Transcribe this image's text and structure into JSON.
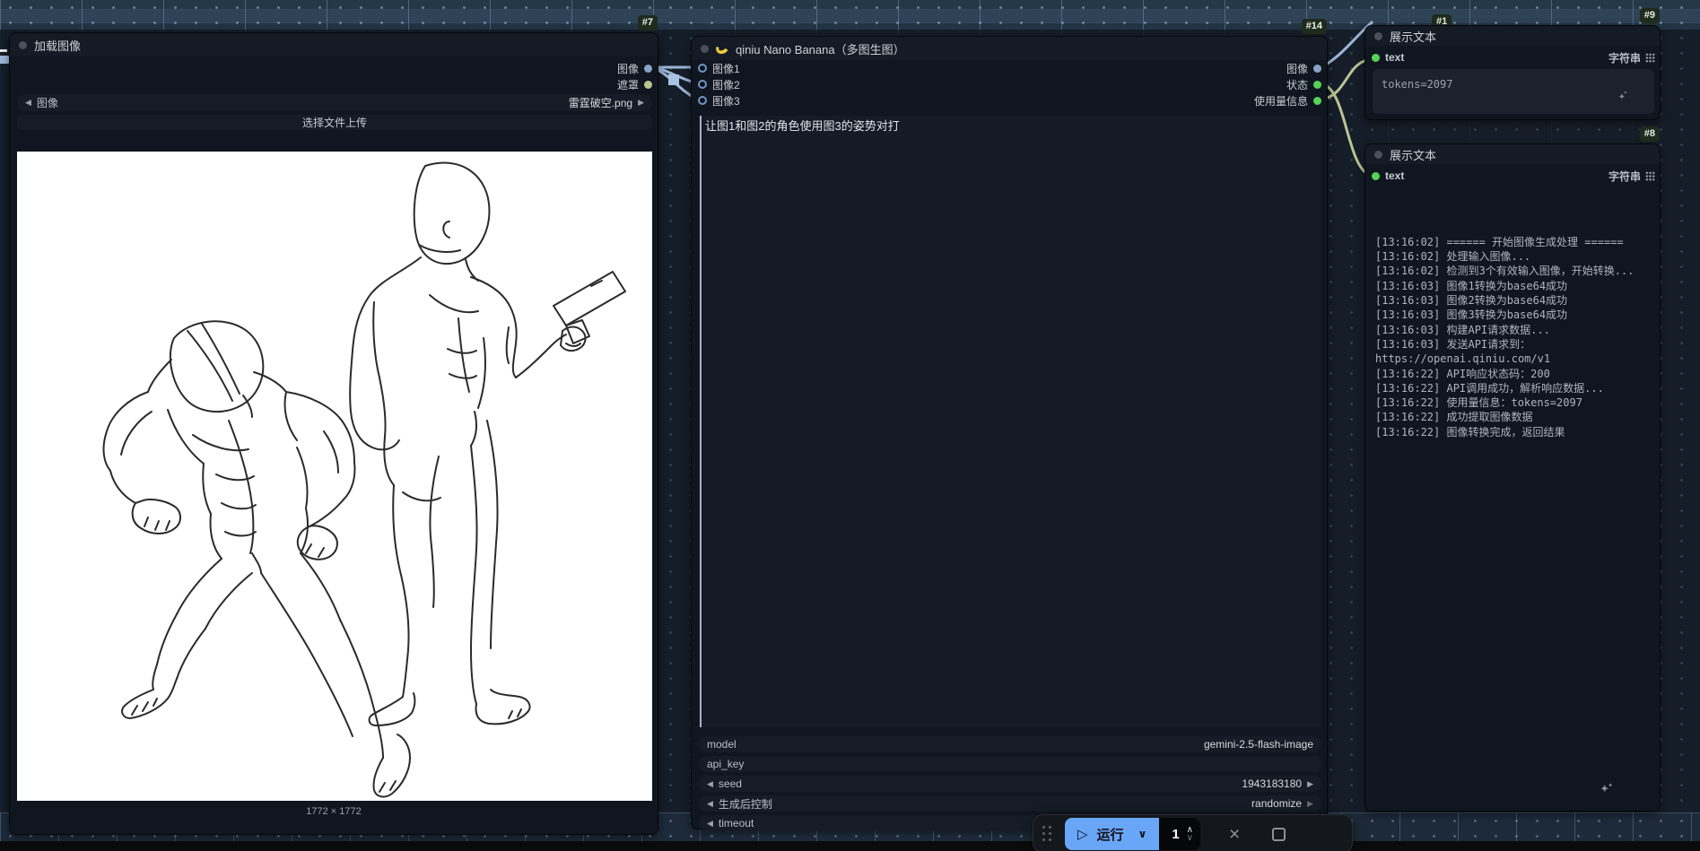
{
  "colors": {
    "accent_blue": "#6aa6f8",
    "link_image": "#9cb6da",
    "link_string": "#b9c394",
    "socket_image": "#8aa3c8",
    "socket_mask": "#b9c48f",
    "socket_string": "#56d356",
    "badge_bg": "#1e2b1d"
  },
  "nodes": {
    "load_image": {
      "id": "#7",
      "title": "加载图像",
      "outputs": [
        {
          "label": "图像"
        },
        {
          "label": "遮罩"
        }
      ],
      "combo": {
        "label": "图像",
        "value": "雷霆破空.png"
      },
      "upload_button": "选择文件上传",
      "size_label": "1772 × 1772"
    },
    "nano_banana": {
      "id": "#14",
      "title": "qiniu Nano Banana（多图生图）",
      "inputs": [
        "图像1",
        "图像2",
        "图像3"
      ],
      "outputs": [
        "图像",
        "状态",
        "使用量信息"
      ],
      "prompt": "让图1和图2的角色使用图3的姿势对打",
      "widgets": [
        {
          "label": "model",
          "value": "gemini-2.5-flash-image"
        },
        {
          "label": "api_key",
          "value": ""
        },
        {
          "label": "seed",
          "value": "1943183180"
        },
        {
          "label": "生成后控制",
          "value": "randomize"
        },
        {
          "label": "timeout",
          "value": ""
        }
      ]
    },
    "show_text_top": {
      "id": "#9",
      "title": "展示文本",
      "input_label": "text",
      "type_label": "字符串",
      "value": "tokens=2097"
    },
    "show_text_bottom": {
      "id": "#8",
      "title": "展示文本",
      "input_label": "text",
      "type_label": "字符串",
      "log_lines": [
        "[13:16:02] ====== 开始图像生成处理 ======",
        "[13:16:02] 处理输入图像...",
        "[13:16:02] 检测到3个有效输入图像，开始转换...",
        "[13:16:03] 图像1转换为base64成功",
        "[13:16:03] 图像2转换为base64成功",
        "[13:16:03] 图像3转换为base64成功",
        "[13:16:03] 构建API请求数据...",
        "[13:16:03] 发送API请求到：",
        "https://openai.qiniu.com/v1",
        "[13:16:22] API响应状态码：200",
        "[13:16:22] API调用成功，解析响应数据...",
        "[13:16:22] 使用量信息：tokens=2097",
        "[13:16:22] 成功提取图像数据",
        "[13:16:22] 图像转换完成，返回结果"
      ]
    }
  },
  "hidden_badge": "#1",
  "toolbar": {
    "run_label": "运行",
    "batch_count": "1"
  },
  "icons": {
    "prev": "◀",
    "next": "▶",
    "play": "▷",
    "chevron_down": "∨",
    "chevron_up": "∧",
    "close": "×",
    "sparkle": "✦"
  }
}
